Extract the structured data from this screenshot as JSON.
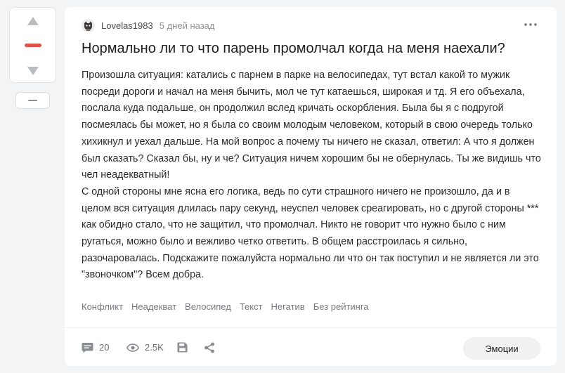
{
  "vote": {
    "rating_color": "#e2514a"
  },
  "post": {
    "author": "Lovelas1983",
    "time": "5 дней назад",
    "title": "Нормально ли то что парень промолчал когда на меня наехали?",
    "paragraphs": [
      "Произошла ситуация: катались с парнем в парке на велосипедах, тут встал какой то мужик посреди дороги и начал на меня бычить, мол че тут катаешься, широкая и тд. Я его объехала, послала куда подальше, он продолжил вслед кричать оскорбления. Была бы я с подругой посмеялась бы может, но я была со своим молодым человеком, который в свою очередь только хихикнул и уехал дальше. На мой вопрос а почему ты ничего не сказал, ответил: А что я должен был сказать? Сказал бы, ну и че? Ситуация ничем хорошим бы не обернулась. Ты же видишь что чел неадекватный!",
      "С одной стороны мне ясна его логика, ведь по сути страшного ничего не произошло, да и в целом вся ситуация длилась пару секунд, неуспел человек среагировать, но с другой стороны *** как обидно стало, что не защитил, что промолчал. Никто не говорит что нужно было с ним ругаться, можно было и вежливо четко ответить. В общем расстроилась я сильно, разочаровалась. Подскажите пожалуйста нормально ли что он так поступил и не является ли это \"звоночком\"? Всем добра."
    ],
    "tags": [
      "Конфликт",
      "Неадекват",
      "Велосипед",
      "Текст",
      "Негатив",
      "Без рейтинга"
    ]
  },
  "footer": {
    "comments_count": "20",
    "views_count": "2.5K",
    "emotions_label": "Эмоции"
  },
  "icons": {
    "upvote": "triangle-up-icon",
    "downvote": "triangle-down-icon",
    "collapse": "minus-icon",
    "more": "more-dots-icon",
    "comments": "comment-icon",
    "views": "eye-icon",
    "save": "save-icon",
    "share": "share-icon"
  }
}
